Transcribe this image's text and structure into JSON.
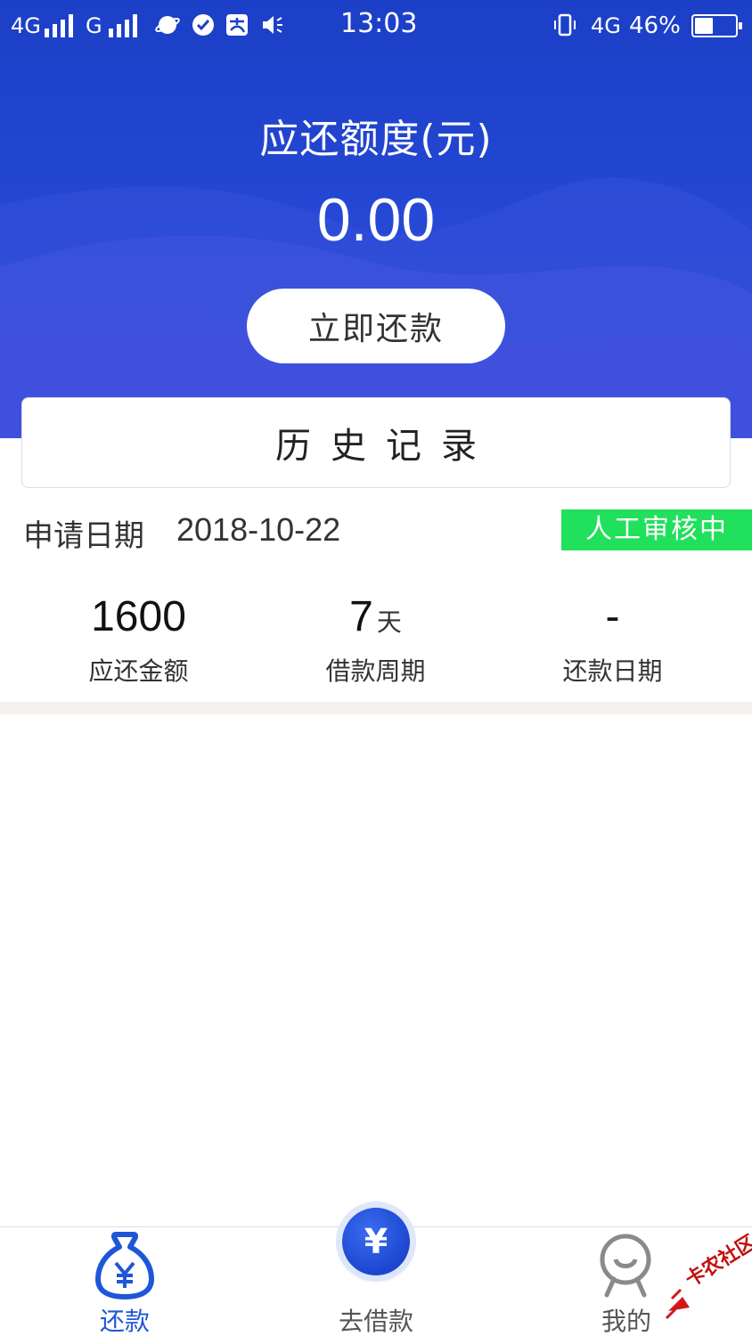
{
  "status_bar": {
    "network_left": "4G",
    "network_left2": "G",
    "network_right": "4G",
    "battery_percent": "46%",
    "battery_level": 0.46,
    "time": "13:03"
  },
  "header": {
    "amount_title": "应还额度(元)",
    "amount_value": "0.00",
    "repay_button": "立即还款"
  },
  "history": {
    "title": "历史记录"
  },
  "application": {
    "date_label": "申请日期",
    "date_value": "2018-10-22",
    "status": "人工审核中"
  },
  "stats": [
    {
      "value": "1600",
      "unit": "",
      "label": "应还金额"
    },
    {
      "value": "7",
      "unit": "天",
      "label": "借款周期"
    },
    {
      "value": "-",
      "unit": "",
      "label": "还款日期"
    }
  ],
  "nav": {
    "repay": "还款",
    "borrow": "去借款",
    "mine": "我的",
    "borrow_symbol": "¥"
  },
  "watermark": {
    "text": "卡农社区"
  },
  "colors": {
    "header_blue": "#1b3fc6",
    "accent_blue": "#1e56d8",
    "status_green": "#20e05c"
  }
}
